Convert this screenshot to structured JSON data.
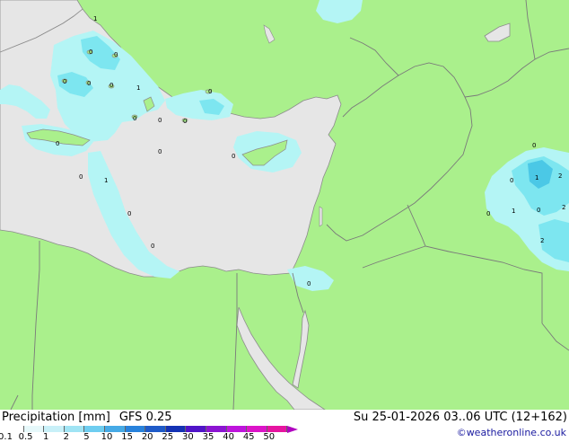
{
  "map": {
    "colors": {
      "land": "#aaf08c",
      "sea": "#e6e6e6",
      "precip_light": "#b4f5f5",
      "precip_mid": "#7de6f0",
      "precip_heavy": "#4bc8e6",
      "border": "#7a7a7a",
      "coast": "#8c8c8c"
    },
    "labels": [
      "1",
      "0",
      "0",
      "0",
      "0",
      "0",
      "1",
      "0",
      "0",
      "0",
      "0",
      "0",
      "0",
      "0",
      "0",
      "1",
      "0",
      "0",
      "0",
      "0",
      "1",
      "2",
      "0",
      "1",
      "0",
      "2",
      "0",
      "2"
    ]
  },
  "footer": {
    "title": "Precipitation [mm]",
    "model": "GFS 0.25",
    "datetime": "Su 25-01-2026 03..06 UTC (12+162)",
    "credit": "©weatheronline.co.uk",
    "scale": [
      {
        "label": "0.1",
        "color": "#ffffff"
      },
      {
        "label": "0.5",
        "color": "#e6f8fa"
      },
      {
        "label": "1",
        "color": "#c8f0f8"
      },
      {
        "label": "2",
        "color": "#a0e4f4"
      },
      {
        "label": "5",
        "color": "#6ecdf0"
      },
      {
        "label": "10",
        "color": "#46aae6"
      },
      {
        "label": "15",
        "color": "#2882dc"
      },
      {
        "label": "20",
        "color": "#1e5ac8"
      },
      {
        "label": "25",
        "color": "#1432b4"
      },
      {
        "label": "30",
        "color": "#5014c8"
      },
      {
        "label": "35",
        "color": "#8c14d2"
      },
      {
        "label": "40",
        "color": "#be14dc"
      },
      {
        "label": "45",
        "color": "#dc14c8"
      },
      {
        "label": "50",
        "color": "#e614a0"
      }
    ]
  }
}
